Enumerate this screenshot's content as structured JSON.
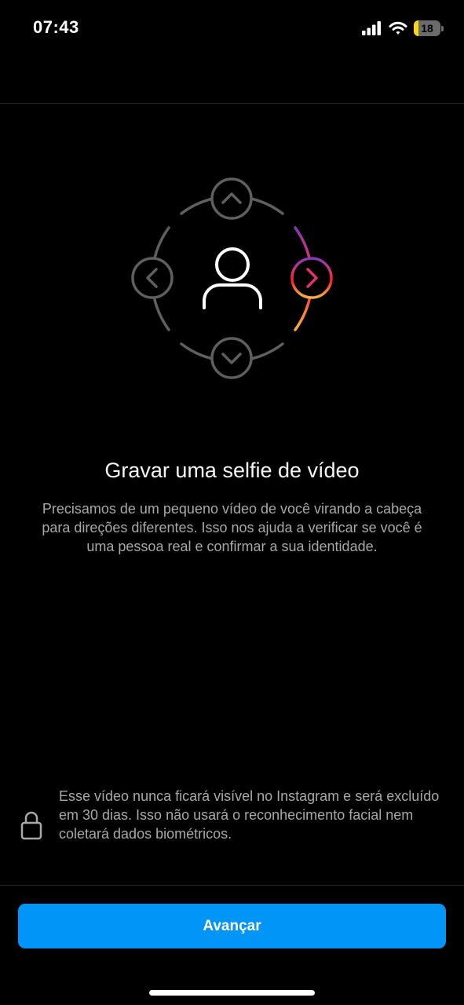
{
  "status_bar": {
    "time": "07:43",
    "battery_level": "18",
    "battery_fraction": 0.18,
    "icons": [
      "cellular-signal-icon",
      "wifi-icon",
      "battery-icon"
    ],
    "battery_color": "#ffd60a"
  },
  "illustration": {
    "icons": [
      "head-turn-diagram",
      "chevron-up-icon",
      "chevron-down-icon",
      "chevron-left-icon",
      "chevron-right-icon",
      "person-icon"
    ],
    "active_direction": "right",
    "gradient_colors": [
      "#833ab4",
      "#e1306c",
      "#fd1d1d",
      "#f77737",
      "#fcaf45"
    ]
  },
  "content": {
    "title": "Gravar uma selfie de vídeo",
    "description": "Precisamos de um pequeno vídeo de você virando a cabeça para direções diferentes. Isso nos ajuda a verificar se você é uma pessoa real e confirmar a sua identidade."
  },
  "privacy": {
    "icon": "lock-icon",
    "text": "Esse vídeo nunca ficará visível no Instagram e será excluído em 30 dias. Isso não usará o reconhecimento facial nem coletará dados biométricos."
  },
  "footer": {
    "button_label": "Avançar",
    "button_color": "#0095f6"
  }
}
